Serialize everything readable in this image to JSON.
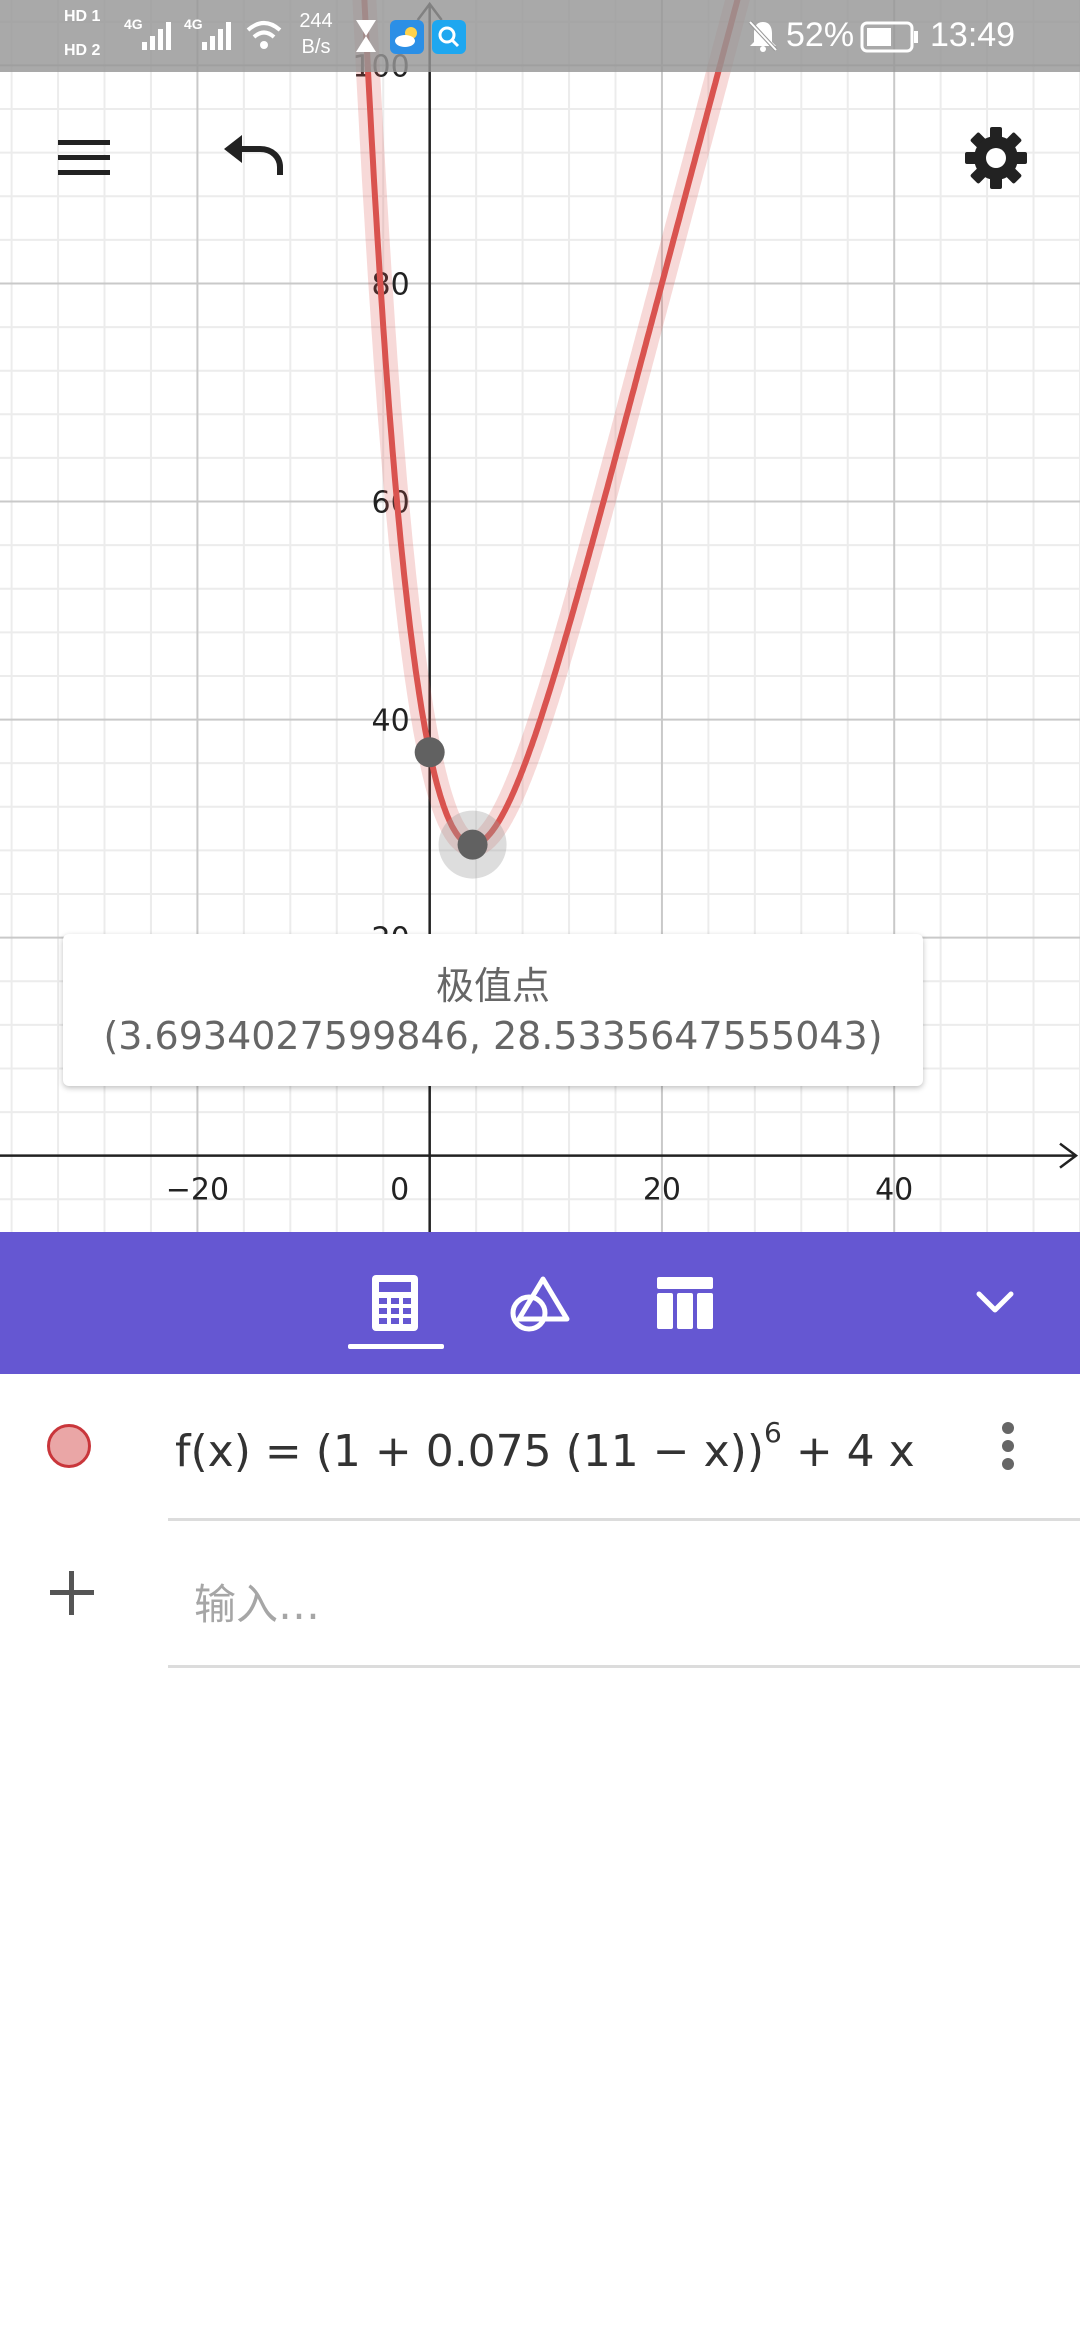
{
  "status_bar": {
    "sim1": "HD 1",
    "sim2": "HD 2",
    "net1": "4G",
    "net2": "4G",
    "speed_value": "244",
    "speed_unit": "B/s",
    "battery": "52%",
    "time": "13:49"
  },
  "toolbar": {
    "menu_icon": "hamburger-menu-icon",
    "undo_icon": "undo-icon",
    "settings_icon": "gear-icon"
  },
  "graph": {
    "function_color": "#d9534f",
    "point_color": "#616161",
    "x_ticks": [
      "−20",
      "0",
      "20",
      "40"
    ],
    "y_ticks": [
      "100",
      "80",
      "60",
      "40",
      "20"
    ],
    "x_range": [
      -37,
      56
    ],
    "y_range": [
      -7,
      106
    ],
    "points": [
      {
        "x": 0,
        "y": 37.0
      },
      {
        "x": 3.6934027599846,
        "y": 28.5335647555043
      }
    ]
  },
  "tooltip": {
    "title": "极值点",
    "coords": "(3.6934027599846, 28.5335647555043)"
  },
  "tabs": [
    {
      "name": "algebra-tab",
      "icon": "calculator-icon",
      "active": true
    },
    {
      "name": "tools-tab",
      "icon": "shapes-icon",
      "active": false
    },
    {
      "name": "table-tab",
      "icon": "table-icon",
      "active": false
    },
    {
      "name": "collapse",
      "icon": "chevron-down-icon",
      "active": false
    }
  ],
  "algebra": {
    "formula_prefix": "f(x) = (1 + 0.075 (11 − x))",
    "formula_exp": "6",
    "formula_suffix": " + 4 x",
    "input_placeholder": "输入…",
    "accent": "#6557d2"
  }
}
